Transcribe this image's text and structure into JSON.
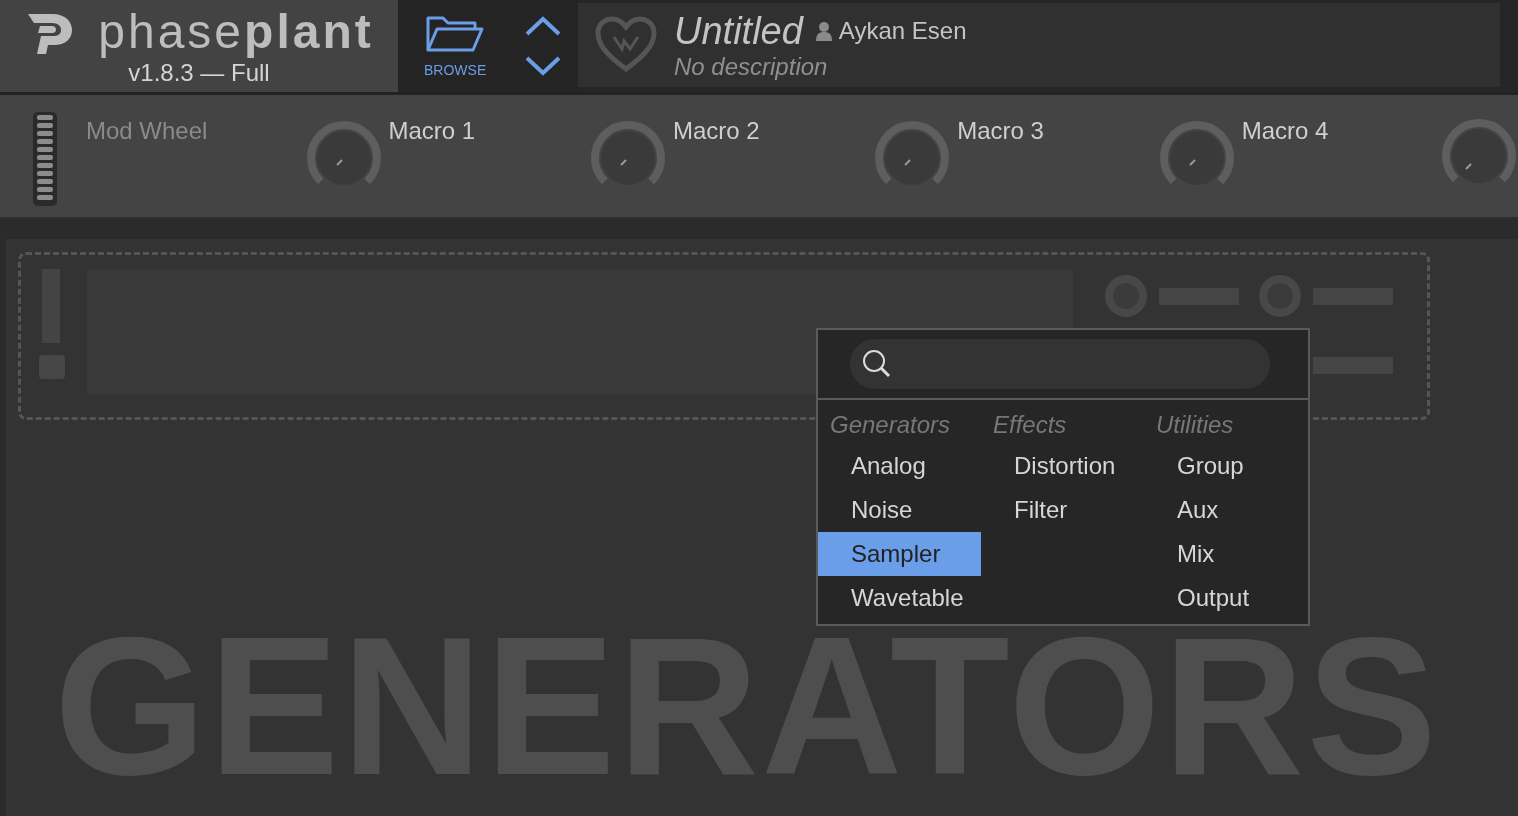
{
  "header": {
    "logo_text": "phase**plant**",
    "version": "v1.8.3 — Full",
    "browse_label": "BROWSE",
    "preset": {
      "title": "Untitled",
      "author": "Aykan Esen",
      "description": "No description"
    }
  },
  "mod_wheel": {
    "label": "Mod Wheel",
    "disabled": true
  },
  "macros": [
    {
      "name": "Macro 1"
    },
    {
      "name": "Macro 2"
    },
    {
      "name": "Macro 3"
    },
    {
      "name": "Macro 4"
    }
  ],
  "background_label": "GENERATORS",
  "module_menu": {
    "columns": [
      {
        "heading": "Generators",
        "items": [
          {
            "label": "Analog",
            "selected": false
          },
          {
            "label": "Noise",
            "selected": false
          },
          {
            "label": "Sampler",
            "selected": true
          },
          {
            "label": "Wavetable",
            "selected": false
          }
        ]
      },
      {
        "heading": "Effects",
        "items": [
          {
            "label": "Distortion",
            "selected": false
          },
          {
            "label": "Filter",
            "selected": false
          }
        ]
      },
      {
        "heading": "Utilities",
        "items": [
          {
            "label": "Group",
            "selected": false
          },
          {
            "label": "Aux",
            "selected": false
          },
          {
            "label": "Mix",
            "selected": false
          },
          {
            "label": "Output",
            "selected": false
          }
        ]
      }
    ]
  }
}
